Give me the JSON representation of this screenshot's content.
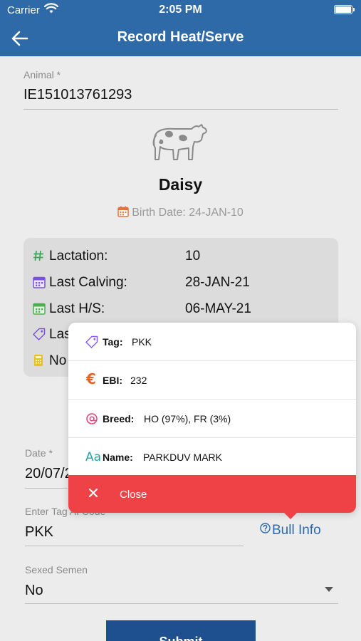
{
  "status_bar": {
    "carrier": "Carrier",
    "time": "2:05 PM"
  },
  "nav": {
    "title": "Record Heat/Serve"
  },
  "animal": {
    "label": "Animal *",
    "value": "IE151013761293"
  },
  "profile": {
    "name": "Daisy",
    "birth_date": "Birth Date: 24-JAN-10"
  },
  "stats": [
    {
      "label": "Lactation:",
      "value": "10",
      "icon": "hash-icon"
    },
    {
      "label": "Last Calving:",
      "value": "28-JAN-21",
      "icon": "calendar-icon"
    },
    {
      "label": "Last H/S:",
      "value": "06-MAY-21",
      "icon": "calendar-icon"
    },
    {
      "label": "Las",
      "value": "",
      "icon": "tag-icon"
    },
    {
      "label": "No",
      "value": "",
      "icon": "calculator-icon"
    }
  ],
  "date": {
    "label": "Date *",
    "value": "20/07/2"
  },
  "tag_ai": {
    "label": "Enter Tag AI Code",
    "value": "PKK"
  },
  "bull_info": {
    "label": "Bull Info"
  },
  "sexed_semen": {
    "label": "Sexed Semen",
    "value": "No"
  },
  "submit": {
    "label": "Submit"
  },
  "popover": {
    "rows": [
      {
        "label": "Tag:",
        "value": "PKK",
        "icon": "tag-icon"
      },
      {
        "label": "EBI:",
        "value": "232",
        "icon": "euro-icon"
      },
      {
        "label": "Breed:",
        "value": "HO (97%), FR (3%)",
        "icon": "at-icon"
      },
      {
        "label": "Name:",
        "value": "PARKDUV MARK",
        "icon": "font-icon"
      }
    ],
    "close_label": "Close"
  },
  "colors": {
    "header": "#2e6aa8",
    "close_bar": "#ee4246",
    "submit": "#1e4f8f",
    "card": "#dcdcdc"
  }
}
